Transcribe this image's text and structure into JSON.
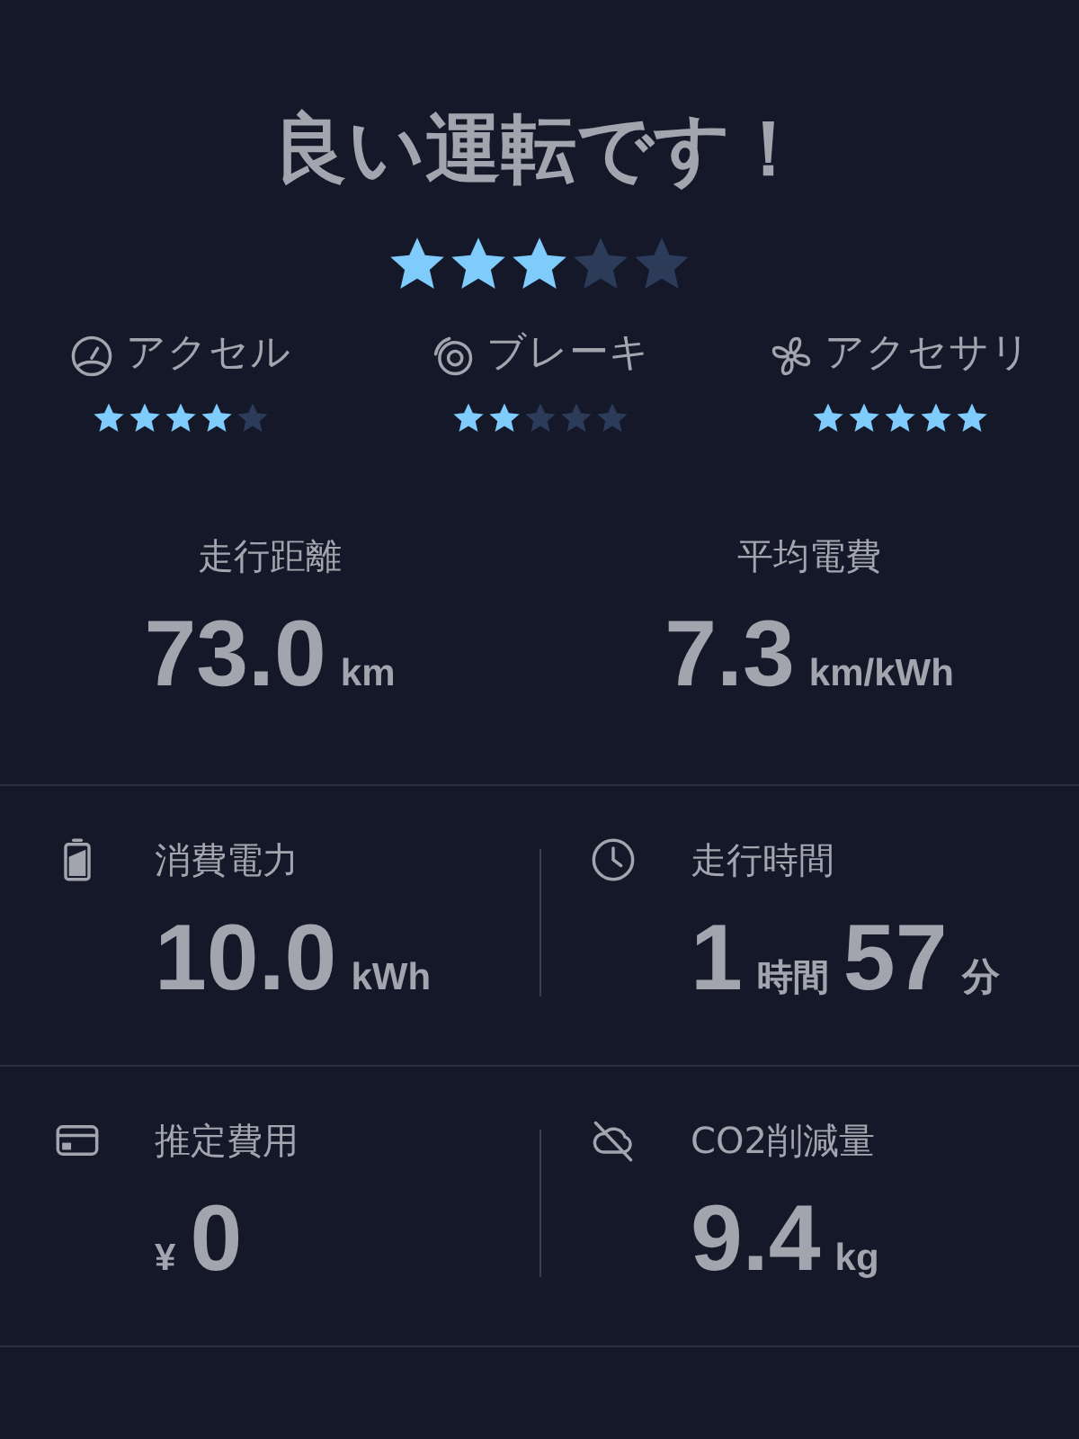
{
  "title": "良い運転です！",
  "overall": {
    "stars": 3
  },
  "categories": [
    {
      "kind": "gauge",
      "label": "アクセル",
      "stars": 4
    },
    {
      "kind": "brake",
      "label": "ブレーキ",
      "stars": 2
    },
    {
      "kind": "fan",
      "label": "アクセサリ",
      "stars": 5
    }
  ],
  "summary": [
    {
      "label": "走行距離",
      "value": [
        {
          "kind": "number",
          "text": "73.0"
        },
        {
          "kind": "unit",
          "text": "km"
        }
      ]
    },
    {
      "label": "平均電費",
      "value": [
        {
          "kind": "number",
          "text": "7.3"
        },
        {
          "kind": "unit",
          "text": "km/kWh"
        }
      ]
    }
  ],
  "stats": [
    {
      "kind": "battery",
      "label": "消費電力",
      "value": [
        {
          "kind": "number",
          "text": "10.0"
        },
        {
          "kind": "unit",
          "text": "kWh"
        }
      ]
    },
    {
      "kind": "clock",
      "label": "走行時間",
      "value": [
        {
          "kind": "number",
          "text": "1"
        },
        {
          "kind": "unit",
          "text": "時間"
        },
        {
          "kind": "number",
          "text": "57"
        },
        {
          "kind": "unit",
          "text": "分"
        }
      ]
    },
    {
      "kind": "card",
      "label": "推定費用",
      "value": [
        {
          "kind": "unit",
          "text": "¥"
        },
        {
          "kind": "number",
          "text": "0"
        }
      ]
    },
    {
      "kind": "cloud-off",
      "label": "CO2削減量",
      "value": [
        {
          "kind": "number",
          "text": "9.4"
        },
        {
          "kind": "unit",
          "text": "kg"
        }
      ]
    }
  ]
}
